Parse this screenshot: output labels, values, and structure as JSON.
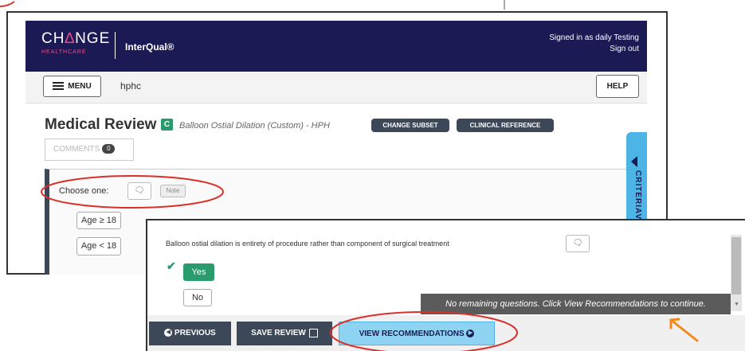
{
  "header": {
    "logo_main_a": "CH",
    "logo_main_tri": "∆",
    "logo_main_b": "NGE",
    "logo_sub": "HEALTHCARE",
    "product": "InterQual®",
    "signed_in": "Signed in as daily Testing",
    "sign_out": "Sign out"
  },
  "toolbar": {
    "menu_label": "MENU",
    "search_value": "hphc",
    "help_label": "HELP"
  },
  "review": {
    "title": "Medical Review",
    "badge": "C",
    "subset": "Balloon Ostial Dilation (Custom) - HPH",
    "change_subset": "CHANGE SUBSET",
    "clinical_reference": "CLINICAL REFERENCE",
    "comments_label": "COMMENTS",
    "comments_count": "0"
  },
  "question1": {
    "label": "Choose one:",
    "note": "Note",
    "options": [
      "Age ≥ 18",
      "Age < 18"
    ]
  },
  "criteria_tab": "CRITERIAV",
  "question2": {
    "text": "Balloon ostial dilation is entirety of procedure rather than component of surgical treatment",
    "yes": "Yes",
    "no": "No"
  },
  "tooltip": "No remaining questions. Click View Recommendations to continue.",
  "footer": {
    "previous": "PREVIOUS",
    "save_review": "SAVE REVIEW",
    "view_recommendations": "VIEW RECOMMENDATIONS"
  },
  "colors": {
    "header_bg": "#1b1a55",
    "green": "#2a9b6c",
    "accent_blue": "#4db4e6",
    "annotation_red": "#d9302c",
    "annotation_arrow": "#f08a1c"
  }
}
